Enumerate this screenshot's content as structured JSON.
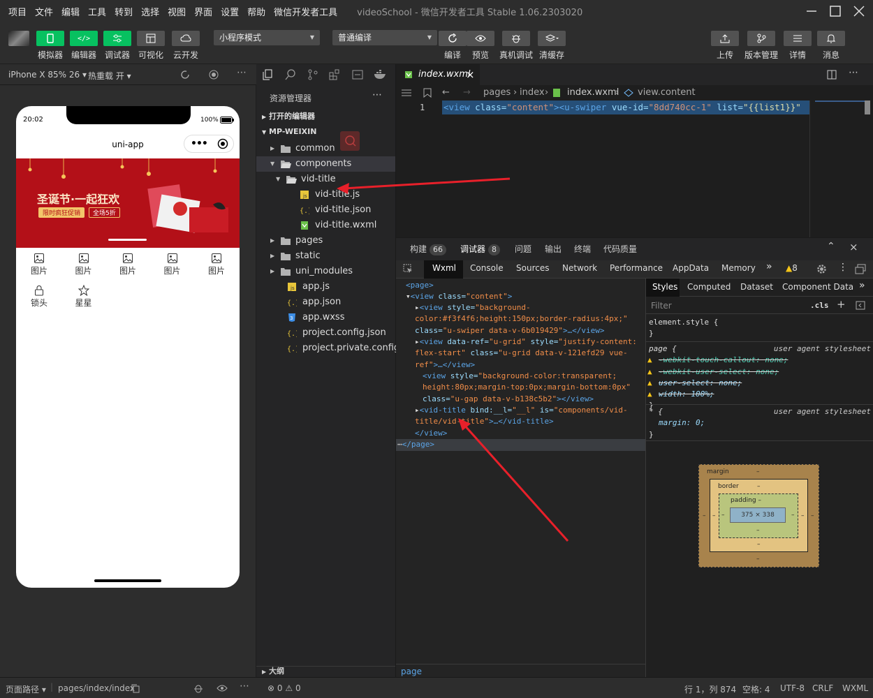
{
  "menubar": {
    "items": [
      "项目",
      "文件",
      "编辑",
      "工具",
      "转到",
      "选择",
      "视图",
      "界面",
      "设置",
      "帮助",
      "微信开发者工具"
    ],
    "window_title": "videoSchool - 微信开发者工具 Stable 1.06.2303020"
  },
  "toolbar": {
    "simulator": "模拟器",
    "editor": "编辑器",
    "debugger": "调试器",
    "visual": "可视化",
    "cloud": "云开发",
    "mode": "小程序模式",
    "compile_mode": "普通编译",
    "compile": "编译",
    "preview": "预览",
    "real_debug": "真机调试",
    "clear_cache": "清缓存",
    "upload": "上传",
    "version": "版本管理",
    "details": "详情",
    "messages": "消息"
  },
  "simulator": {
    "device": "iPhone X 85% 26",
    "hotreload": "热重载 开",
    "time": "20:02",
    "battery": "100%",
    "nav_title": "uni-app",
    "banner_title": "圣诞节·一起狂欢",
    "banner_tag1": "限时疯狂促销",
    "banner_tag2": "全场5折",
    "grid": [
      {
        "label": "图片",
        "icon": "image-icon"
      },
      {
        "label": "图片",
        "icon": "image-icon"
      },
      {
        "label": "图片",
        "icon": "image-icon"
      },
      {
        "label": "图片",
        "icon": "image-icon"
      },
      {
        "label": "图片",
        "icon": "image-icon"
      },
      {
        "label": "锁头",
        "icon": "lock-icon"
      },
      {
        "label": "星星",
        "icon": "star-icon"
      }
    ]
  },
  "explorer": {
    "title": "资源管理器",
    "open_editors": "打开的编辑器",
    "project": "MP-WEIXIN",
    "tree": [
      {
        "label": "common",
        "icon": "folder-icon"
      },
      {
        "label": "components",
        "icon": "folder-open-icon"
      },
      {
        "label": "vid-title",
        "icon": "folder-open-icon"
      },
      {
        "label": "vid-title.js",
        "icon": "js-file-icon"
      },
      {
        "label": "vid-title.json",
        "icon": "json-file-icon"
      },
      {
        "label": "vid-title.wxml",
        "icon": "wxml-file-icon"
      },
      {
        "label": "pages",
        "icon": "folder-icon"
      },
      {
        "label": "static",
        "icon": "folder-icon"
      },
      {
        "label": "uni_modules",
        "icon": "folder-icon"
      },
      {
        "label": "app.js",
        "icon": "js-file-icon"
      },
      {
        "label": "app.json",
        "icon": "json-file-icon"
      },
      {
        "label": "app.wxss",
        "icon": "css-file-icon"
      },
      {
        "label": "project.config.json",
        "icon": "json-file-icon"
      },
      {
        "label": "project.private.config.js...",
        "icon": "json-file-icon"
      }
    ],
    "outline": "大纲"
  },
  "editor": {
    "tab": "index.wxml",
    "breadcrumb": [
      "pages",
      "index",
      "index.wxml",
      "view.content"
    ],
    "line_number": "1",
    "line_code": {
      "t1": "<view ",
      "a1": "class=",
      "v1": "\"content\"",
      "t2": "><u-swiper ",
      "a2": "vue-id=",
      "v2": "\"8dd740cc-1\"",
      "a3": " list=",
      "v3": "\"{{list1}}\""
    }
  },
  "devtools": {
    "tabs": [
      {
        "label": "构建",
        "badge": "66"
      },
      {
        "label": "调试器",
        "badge": "8"
      },
      {
        "label": "问题"
      },
      {
        "label": "输出"
      },
      {
        "label": "终端"
      },
      {
        "label": "代码质量"
      }
    ],
    "panel_tabs": [
      "Wxml",
      "Console",
      "Sources",
      "Network",
      "Performance",
      "AppData",
      "Memory"
    ],
    "warn_count": "8",
    "style_tabs": [
      "Styles",
      "Computed",
      "Dataset",
      "Component Data"
    ],
    "filter": "Filter",
    "cls": ".cls",
    "element_style": "element.style {",
    "page_rule": "page {",
    "ua_sheet": "user agent stylesheet",
    "props": [
      "-webkit-touch-callout: none;",
      "-webkit-user-select: none;",
      "user-select: none;",
      "width: 100%;"
    ],
    "star_rule": "* {",
    "margin_prop": "margin: 0;",
    "close_brace": "}",
    "box": {
      "margin": "margin",
      "border": "border",
      "padding": "padding",
      "content": "375 × 338",
      "dash": "–"
    },
    "footer": "page"
  },
  "wxml": {
    "page_open": "<page>",
    "view_open": "<view",
    "class_attr": "class=",
    "content_val": "\"content\"",
    "close_gt": ">",
    "swiper_attrs": "style=",
    "swiper_style": "\"background-color:#f3f4f6;height:150px;border-radius:4px;\"",
    "swiper_class": "\"u-swiper data-v-6b019429\"",
    "ellipsis": ">…</view>",
    "grid_attrs": "data-ref=",
    "grid_ref": "\"u-grid\"",
    "grid_style": "\"justify-content: flex-start\"",
    "grid_class": "\"u-grid data-v-121efd29 vue-ref\"",
    "gap_style": "\"background-color:transparent; height:80px;margin-top:0px;margin-bottom:0px\"",
    "gap_class": "\"u-gap data-v-b138c5b2\"",
    "gap_end": "></view>",
    "vid_tag": "<vid-title",
    "vid_bind": " bind:__l=",
    "vid_bind_val": "\"__l\"",
    "vid_is": " is=",
    "vid_is_val": "\"components/vid-title/vid-title\"",
    "vid_end": ">…</vid-title>",
    "view_close": "</view>",
    "page_close": "</page>"
  },
  "status": {
    "path_label": "页面路径",
    "path": "pages/index/index",
    "errors": "0",
    "warnings": "0",
    "position": "行 1，列 874",
    "spaces": "空格: 4",
    "encoding": "UTF-8",
    "eol": "CRLF",
    "language": "WXML"
  },
  "colors": {
    "green": "#07c160",
    "banner": "#b31018",
    "arrow": "#e8202a"
  }
}
